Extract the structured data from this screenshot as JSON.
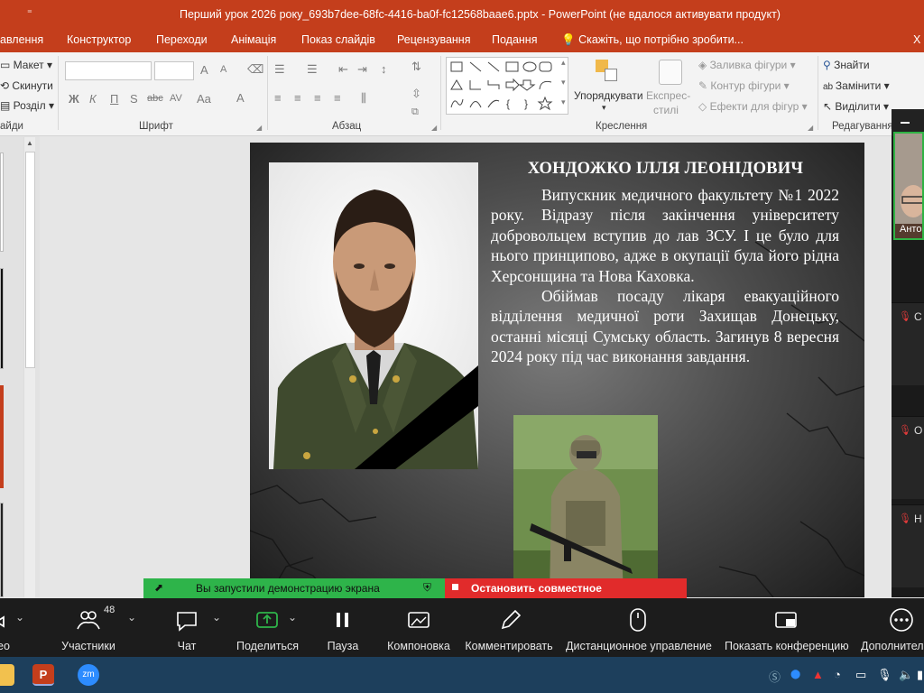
{
  "window": {
    "title": "Перший урок 2026 року_693b7dee-68fc-4416-ba0f-fc12568baae6.pptx - PowerPoint (не вдалося активувати продукт)",
    "qat_glyph": "⁼"
  },
  "menu": {
    "tabs": [
      "авлення",
      "Конструктор",
      "Переходи",
      "Анімація",
      "Показ слайдів",
      "Рецензування",
      "Подання"
    ],
    "tell_me": "Скажіть, що потрібно зробити...",
    "edge_char": "Х"
  },
  "ribbon": {
    "slides": {
      "layout": "Макет",
      "reset": "Скинути",
      "section": "Розділ",
      "group": "айди"
    },
    "font": {
      "group": "Шрифт",
      "bold": "Ж",
      "italic": "К",
      "underline": "П",
      "shadow": "S",
      "strike": "abc",
      "spacing": "AV",
      "case": "Aa",
      "color": "A",
      "grow": "A",
      "shrink": "A"
    },
    "paragraph": {
      "group": "Абзац"
    },
    "drawing": {
      "group": "Креслення",
      "arrange": "Упорядкувати",
      "quick_styles_1": "Експрес-",
      "quick_styles_2": "стилі",
      "fill": "Заливка фігури",
      "outline": "Контур фігури",
      "effects": "Ефекти для фігур"
    },
    "editing": {
      "group": "Редагування",
      "find": "Знайти",
      "replace": "Замінити",
      "select": "Виділити"
    }
  },
  "slide": {
    "name": "ХОНДОЖКО ІЛЛЯ ЛЕОНІДОВИЧ",
    "paragraph1": "Випускник медичного факультету №1 2022 року. Відразу після закінчення університету добровольцем вступив до лав ЗСУ. І це було для нього принципово, адже в окупації була його рідна Херсонщина та Нова Каховка.",
    "paragraph2": "Обіймав посаду лікаря евакуаційного відділення медичної роти Захищав Донецьку, останні місяці Сумську область. Загинув 8 вересня 2024 року під час виконання завдання."
  },
  "zoom_panel": {
    "video_name": "Анто",
    "participants": [
      {
        "initial": "С"
      },
      {
        "initial": "О"
      },
      {
        "initial": "Н"
      }
    ]
  },
  "share_banner": {
    "status": "Вы запустили демонстрацию экрана",
    "stop": "Остановить совместное использование"
  },
  "zoom_toolbar": {
    "video_label": "ео",
    "participants_label": "Участники",
    "participants_count": "48",
    "chat": "Чат",
    "share": "Поделиться",
    "pause": "Пауза",
    "layout": "Компоновка",
    "annotate": "Комментировать",
    "remote": "Дистанционное управление",
    "show_conference": "Показать конференцию",
    "more": "Дополнител"
  },
  "taskbar": {
    "zoom_badge": "zm"
  },
  "colors": {
    "powerpoint_accent": "#c43e1c",
    "share_green": "#2eb44a",
    "stop_red": "#e12b2b",
    "zoom_bar": "#1c1c1c",
    "taskbar": "#1d3f5c"
  }
}
